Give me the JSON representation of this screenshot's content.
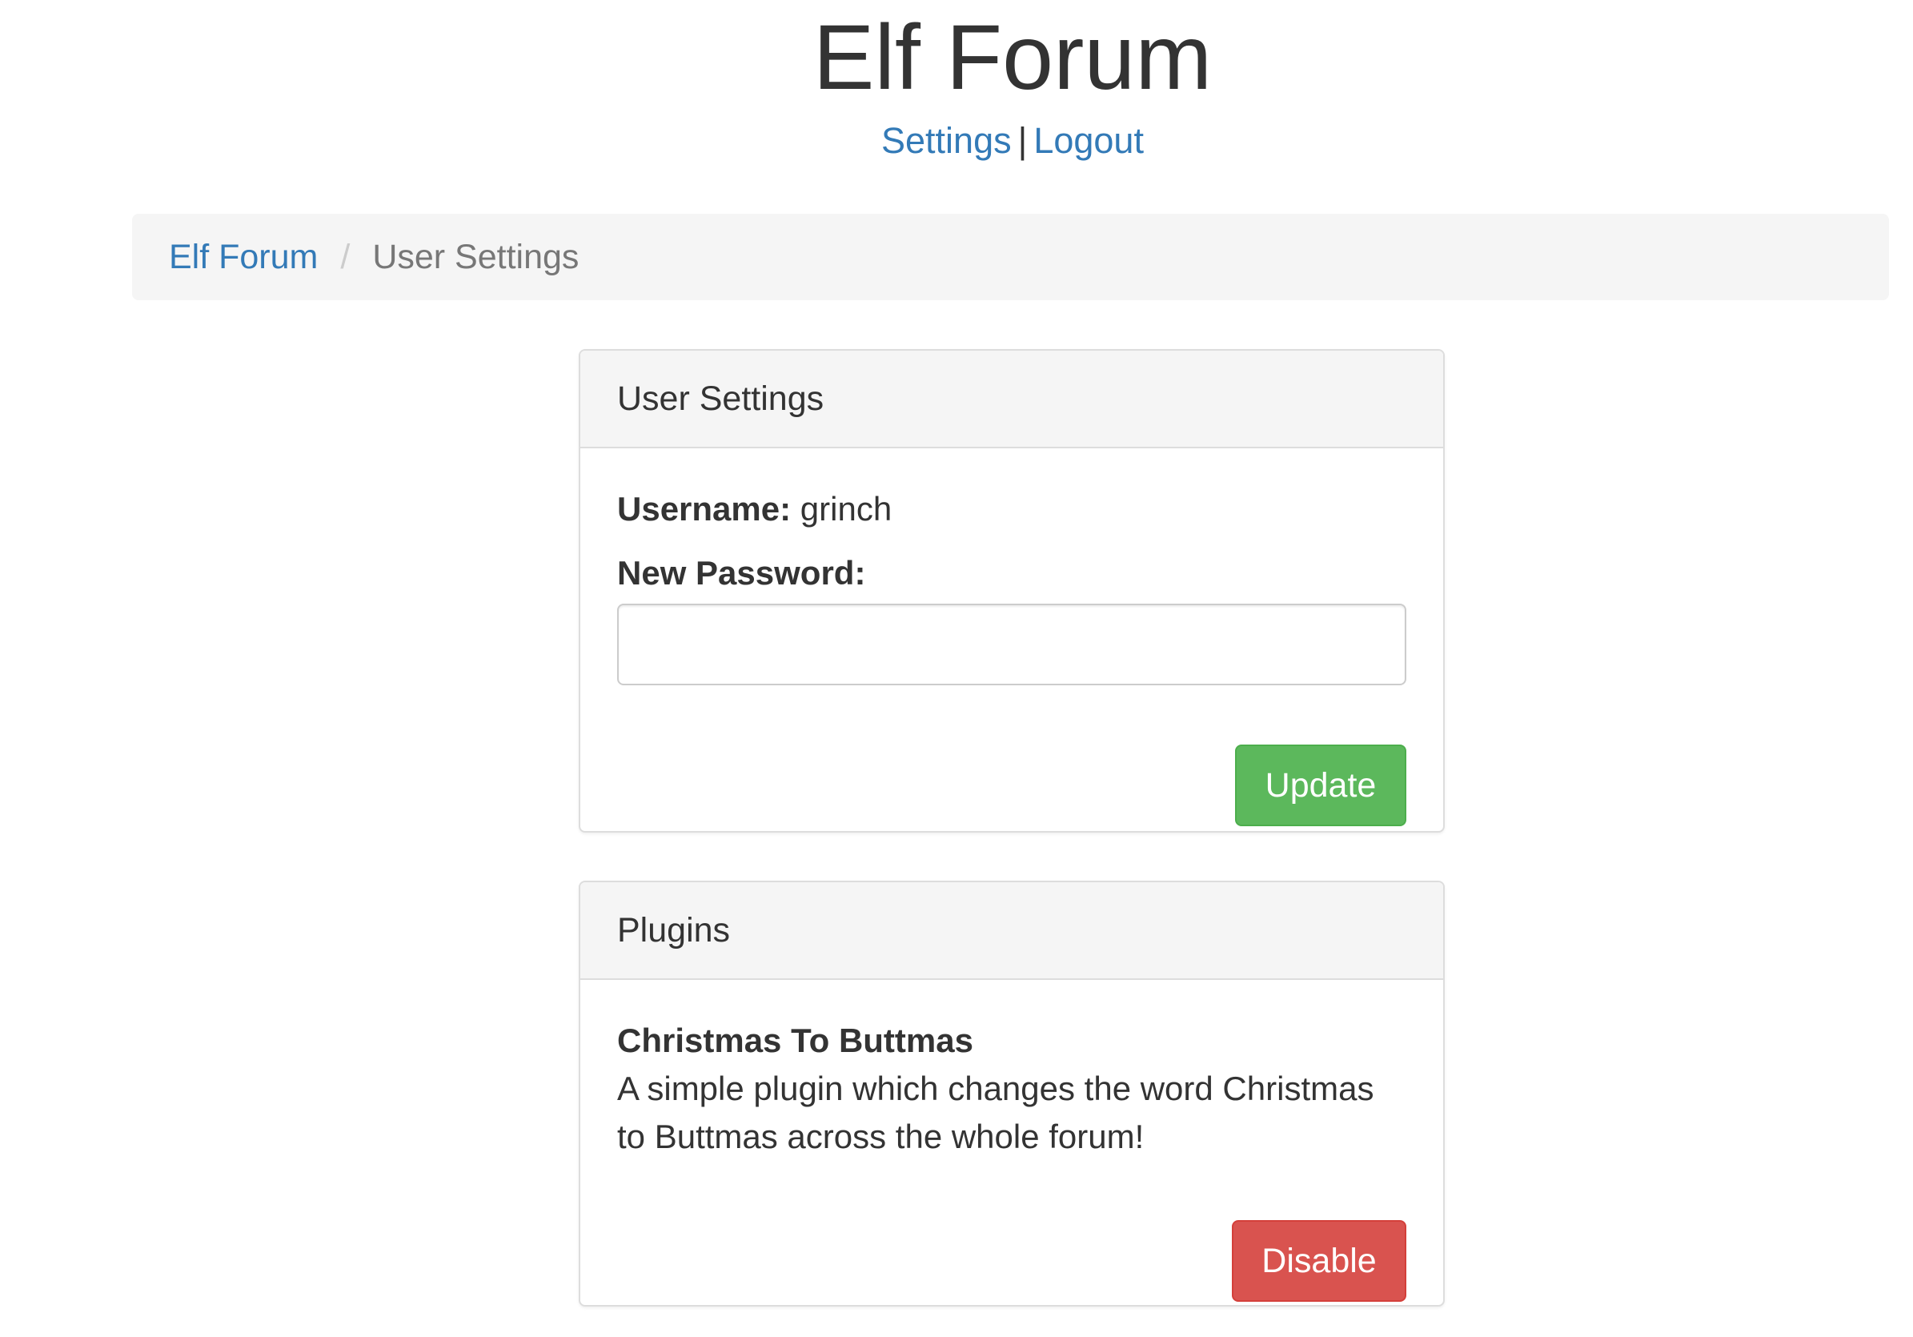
{
  "site": {
    "title": "Elf Forum"
  },
  "top_nav": {
    "settings_label": "Settings",
    "separator": "|",
    "logout_label": "Logout"
  },
  "breadcrumb": {
    "home_label": "Elf Forum",
    "divider": "/",
    "current_label": "User Settings"
  },
  "user_settings": {
    "heading": "User Settings",
    "username_label": "Username:",
    "username_value": "grinch",
    "password_label": "New Password:",
    "password_value": "",
    "update_button": "Update"
  },
  "plugins": {
    "heading": "Plugins",
    "items": [
      {
        "name": "Christmas To Buttmas",
        "description": "A simple plugin which changes the word Christmas to Buttmas across the whole forum!",
        "button": "Disable"
      }
    ]
  },
  "colors": {
    "link": "#337ab7",
    "success": "#5cb85c",
    "danger": "#d9534f",
    "panel_heading_bg": "#f5f5f5"
  }
}
